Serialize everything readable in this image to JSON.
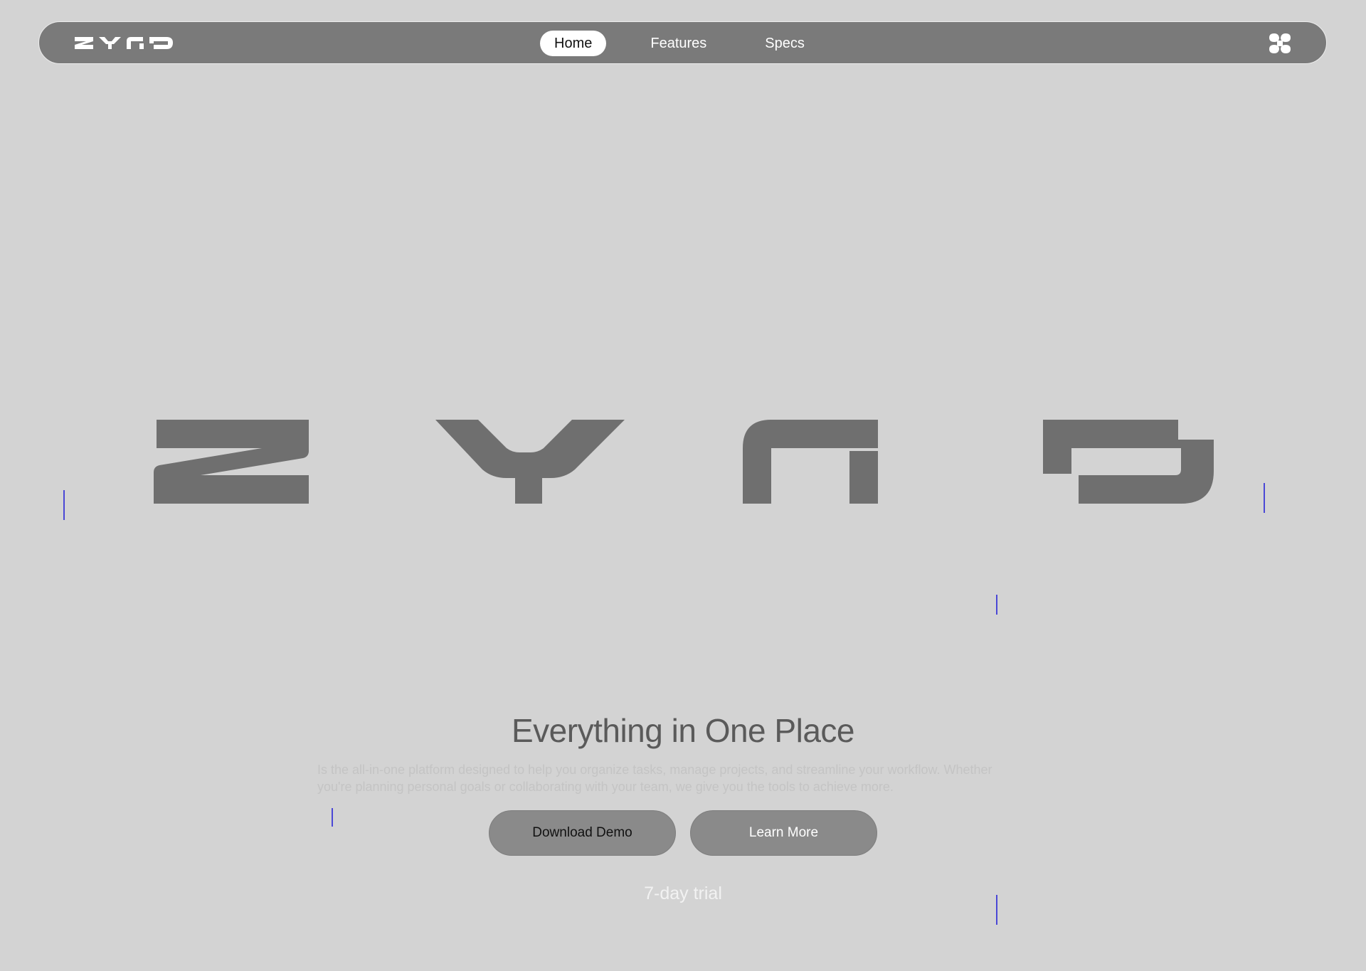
{
  "brand": {
    "name": "zyno",
    "logo_color": "#ffffff",
    "wordmark_color": "#6f6f6f"
  },
  "nav": {
    "links": [
      {
        "label": "Home",
        "active": true
      },
      {
        "label": "Features",
        "active": false
      },
      {
        "label": "Specs",
        "active": false
      }
    ],
    "menu_icon": "four-petal-menu-icon"
  },
  "hero": {
    "title": "Everything in One Place",
    "description": "Is the all-in-one platform designed to help you organize tasks, manage projects, and streamline your workflow. Whether you're planning personal goals or collaborating with your team, we give you the tools to achieve more.",
    "primary_button": "Download Demo",
    "secondary_button": "Learn More",
    "trial_note": "7-day trial"
  },
  "colors": {
    "background": "#d3d3d3",
    "nav_background": "#7a7a7a",
    "button_background": "#8a8a8a",
    "accent_line": "#4a47d6"
  }
}
